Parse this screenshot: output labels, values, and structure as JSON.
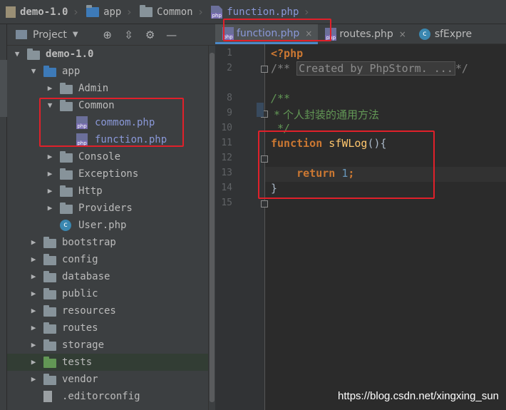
{
  "breadcrumb": {
    "items": [
      "demo-1.0",
      "app",
      "Common",
      "function.php"
    ]
  },
  "project_panel": {
    "title": "Project",
    "tools": [
      "⊕",
      "⇳",
      "⚙",
      "—"
    ],
    "tree": [
      {
        "label": "demo-1.0",
        "type": "project",
        "indent": 0,
        "expanded": true
      },
      {
        "label": "app",
        "type": "folder-blue",
        "indent": 1,
        "expanded": true
      },
      {
        "label": "Admin",
        "type": "folder",
        "indent": 2,
        "expanded": false
      },
      {
        "label": "Common",
        "type": "folder",
        "indent": 2,
        "expanded": true
      },
      {
        "label": "commom.php",
        "type": "php",
        "indent": 3
      },
      {
        "label": "function.php",
        "type": "php",
        "indent": 3
      },
      {
        "label": "Console",
        "type": "folder",
        "indent": 2,
        "expanded": false
      },
      {
        "label": "Exceptions",
        "type": "folder",
        "indent": 2,
        "expanded": false
      },
      {
        "label": "Http",
        "type": "folder",
        "indent": 2,
        "expanded": false
      },
      {
        "label": "Providers",
        "type": "folder",
        "indent": 2,
        "expanded": false
      },
      {
        "label": "User.php",
        "type": "class",
        "indent": 2
      },
      {
        "label": "bootstrap",
        "type": "folder",
        "indent": 1,
        "expanded": false
      },
      {
        "label": "config",
        "type": "folder",
        "indent": 1,
        "expanded": false
      },
      {
        "label": "database",
        "type": "folder",
        "indent": 1,
        "expanded": false
      },
      {
        "label": "public",
        "type": "folder",
        "indent": 1,
        "expanded": false
      },
      {
        "label": "resources",
        "type": "folder",
        "indent": 1,
        "expanded": false
      },
      {
        "label": "routes",
        "type": "folder",
        "indent": 1,
        "expanded": false
      },
      {
        "label": "storage",
        "type": "folder",
        "indent": 1,
        "expanded": false
      },
      {
        "label": "tests",
        "type": "folder-green",
        "indent": 1,
        "expanded": false,
        "selected": true
      },
      {
        "label": "vendor",
        "type": "folder",
        "indent": 1,
        "expanded": false
      },
      {
        "label": ".editorconfig",
        "type": "file",
        "indent": 1
      }
    ]
  },
  "editor": {
    "tabs": [
      {
        "label": "function.php",
        "icon": "php",
        "active": true,
        "close": "×"
      },
      {
        "label": "routes.php",
        "icon": "php",
        "active": false,
        "close": "×"
      },
      {
        "label": "sfExpre",
        "icon": "class",
        "active": false,
        "close": ""
      }
    ],
    "line_numbers": [
      "1",
      "2",
      "8",
      "9",
      "10",
      "11",
      "12",
      "13",
      "14",
      "15"
    ],
    "code": {
      "l1": "<?php",
      "l2a": "/**",
      "l2b": "Created by PhpStorm. ...",
      "l2c": "*/",
      "l9": "/**",
      "l10": " * 个人封装的通用方法",
      "l11": " */",
      "l12_kw": "function",
      "l12_fn": "sfWLog",
      "l12_rest": "(){",
      "l14_kw": "return",
      "l14_num": "1",
      "l14_end": ";",
      "l15": "}"
    }
  },
  "watermark": "https://blog.csdn.net/xingxing_sun",
  "colors": {
    "annotation": "#e0202a",
    "keyword": "#cc7832",
    "function_name": "#ffc66d",
    "doc_comment": "#629755",
    "number": "#6897bb"
  }
}
